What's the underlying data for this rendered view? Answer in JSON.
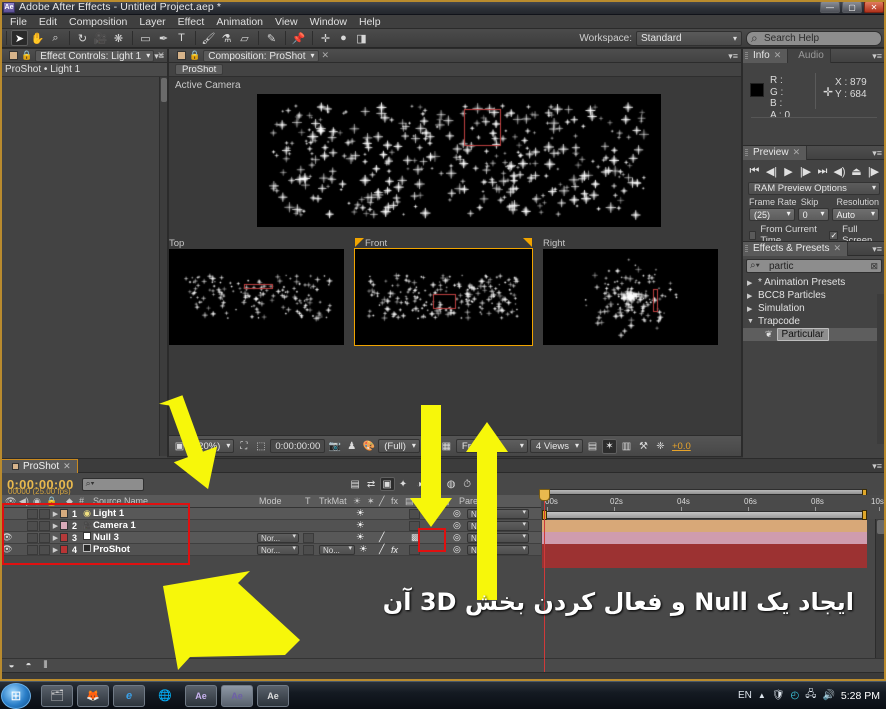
{
  "window": {
    "title": "Adobe After Effects - Untitled Project.aep *",
    "app_badge": "Ae",
    "minimize": "—",
    "maximize": "▢",
    "close": "✕"
  },
  "menu": {
    "items": [
      "File",
      "Edit",
      "Composition",
      "Layer",
      "Effect",
      "Animation",
      "View",
      "Window",
      "Help"
    ]
  },
  "toolbar": {
    "workspace_label": "Workspace:",
    "workspace_value": "Standard",
    "search_help_placeholder": "Search Help",
    "tools": [
      {
        "name": "selection-tool",
        "glyph": "➤"
      },
      {
        "name": "hand-tool",
        "glyph": "✋"
      },
      {
        "name": "zoom-tool",
        "glyph": "⌕"
      },
      {
        "name": "rotation-tool",
        "glyph": "↻"
      },
      {
        "name": "camera-tool",
        "glyph": "🎥"
      },
      {
        "name": "pan-behind-tool",
        "glyph": "✥"
      },
      {
        "name": "shape-tool",
        "glyph": "▭"
      },
      {
        "name": "pen-tool",
        "glyph": "✒"
      },
      {
        "name": "type-tool",
        "glyph": "T"
      },
      {
        "name": "brush-tool",
        "glyph": "🖌"
      },
      {
        "name": "clone-stamp-tool",
        "glyph": "⚷"
      },
      {
        "name": "eraser-tool",
        "glyph": "◳"
      },
      {
        "name": "roto-brush-tool",
        "glyph": "✎"
      },
      {
        "name": "puppet-pin-tool",
        "glyph": "📌"
      }
    ]
  },
  "effect_controls": {
    "tab_label": "Effect Controls: Light 1",
    "breadcrumb": "ProShot • Light 1"
  },
  "composition": {
    "tab_label": "Composition: ProShot",
    "comp_chip": "ProShot",
    "camera_label": "Active Camera",
    "views": [
      "Top",
      "Front",
      "Right"
    ],
    "bottom_bar": {
      "magnification": "(20%)",
      "timecode": "0:00:00:00",
      "resolution": "(Full)",
      "view_select": "Front",
      "view_layout": "4 Views",
      "exposure": "+0.0"
    }
  },
  "info": {
    "tabs": [
      "Info",
      "Audio"
    ],
    "channels": [
      "R :",
      "G :",
      "B :",
      "A : 0"
    ],
    "x": "X : 879",
    "y": "Y : 684"
  },
  "preview": {
    "tab_label": "Preview",
    "transport": [
      "⏮",
      "◀|",
      "▶",
      "|▶",
      "⏭",
      "◀)",
      "⏏",
      "|▶"
    ],
    "options_value": "RAM Preview Options",
    "frame_rate_label": "Frame Rate",
    "frame_rate_value": "(25)",
    "skip_label": "Skip",
    "skip_value": "0",
    "resolution_label": "Resolution",
    "resolution_value": "Auto",
    "from_current_time": "From Current Time",
    "from_current_time_checked": false,
    "full_screen": "Full Screen",
    "full_screen_checked": true
  },
  "effects_presets": {
    "tab_label": "Effects & Presets",
    "search_value": "partic",
    "tree": [
      {
        "label": "* Animation Presets",
        "expanded": false,
        "depth": 0
      },
      {
        "label": "BCC8 Particles",
        "expanded": false,
        "depth": 0
      },
      {
        "label": "Simulation",
        "expanded": false,
        "depth": 0
      },
      {
        "label": "Trapcode",
        "expanded": true,
        "depth": 0
      },
      {
        "label": "Particular",
        "expanded": null,
        "depth": 1,
        "selected": true
      }
    ]
  },
  "timeline": {
    "tab_label": "ProShot",
    "timecode": "0:00:00:00",
    "frame_info": "00000 (25.00 fps)",
    "columns": [
      "Source Name",
      "Mode",
      "T",
      "TrkMat",
      "Parent"
    ],
    "switch_header": "#",
    "layers": [
      {
        "num": "1",
        "name": "Light 1",
        "icon": "light-icon",
        "color": "#d6ab7e",
        "eye": false,
        "mode": null,
        "trkmat": null,
        "parent": "None",
        "threeD": false,
        "fx": false,
        "bar_color": "#d8a878"
      },
      {
        "num": "2",
        "name": "Camera 1",
        "icon": "camera-icon",
        "color": "#d9aab8",
        "eye": false,
        "mode": null,
        "trkmat": null,
        "parent": "None",
        "threeD": false,
        "fx": false,
        "bar_color": "#cf9cae"
      },
      {
        "num": "3",
        "name": "Null 3",
        "icon": "null-icon",
        "color": "#b33a3a",
        "eye": true,
        "mode": "Nor...",
        "trkmat": null,
        "parent": "None",
        "threeD": true,
        "fx": false,
        "bar_color": "#9c3232"
      },
      {
        "num": "4",
        "name": "ProShot",
        "icon": "comp-icon",
        "color": "#b83434",
        "eye": true,
        "mode": "Nor...",
        "trkmat": "No...",
        "parent": "None",
        "threeD": false,
        "fx": true,
        "bar_color": "#9c3232"
      }
    ],
    "ruler_ticks": [
      "00s",
      "02s",
      "04s",
      "06s",
      "08s",
      "10s"
    ]
  },
  "annotation": {
    "farsi_text": "ایجاد یک Null و فعال کردن بخش 3D آن",
    "arrow_color": "#f7f70a",
    "highlight_color": "#e01010"
  },
  "taskbar": {
    "buttons": [
      {
        "name": "explorer",
        "glyph": "🗂"
      },
      {
        "name": "firefox",
        "glyph": "🦊"
      },
      {
        "name": "internet-explorer",
        "glyph": "e"
      },
      {
        "name": "globe",
        "glyph": "🌐"
      },
      {
        "name": "after-effects-1",
        "glyph": "Ae"
      },
      {
        "name": "after-effects-2",
        "glyph": "Ae"
      },
      {
        "name": "after-effects-3",
        "glyph": "Ae"
      }
    ],
    "language": "EN",
    "clock": "5:28 PM"
  }
}
